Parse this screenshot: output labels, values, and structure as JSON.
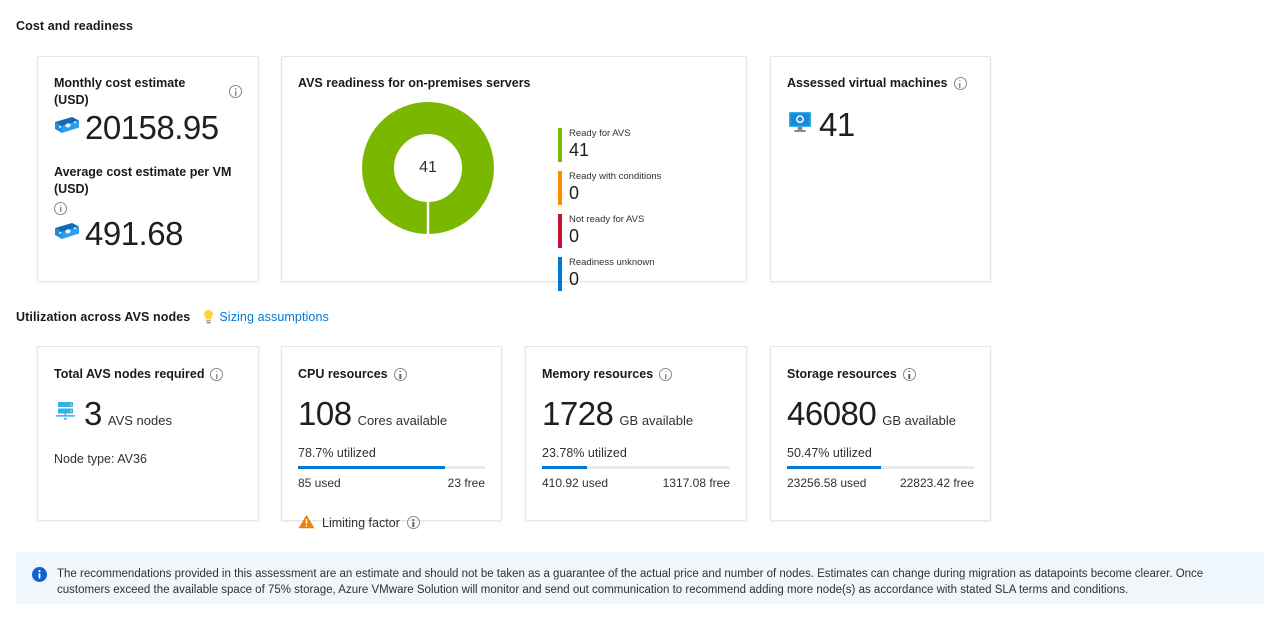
{
  "sections": {
    "cost_readiness": {
      "title": "Cost and readiness"
    },
    "utilization": {
      "title": "Utilization across AVS nodes",
      "link_label": "Sizing assumptions",
      "bulb_icon": "lightbulb-icon"
    }
  },
  "cost_card": {
    "monthly": {
      "title": "Monthly cost estimate (USD)",
      "value": "20158.95",
      "icon": "money-icon",
      "info_icon": "info-icon"
    },
    "average": {
      "title": "Average cost estimate per VM (USD)",
      "value": "491.68",
      "icon": "money-icon",
      "info_icon": "info-icon"
    }
  },
  "readiness_card": {
    "title": "AVS readiness for on-premises servers",
    "center_value": "41"
  },
  "assessed_card": {
    "title": "Assessed virtual machines",
    "value": "41",
    "icon": "virtual-machine-icon",
    "info_icon": "info-icon"
  },
  "nodes_card": {
    "title": "Total AVS nodes required",
    "value": "3",
    "unit": "AVS nodes",
    "node_type": "Node type: AV36",
    "icon": "server-nodes-icon",
    "info_icon": "info-icon"
  },
  "cpu_card": {
    "title": "CPU resources",
    "value": "108",
    "unit": "Cores available",
    "utilized_label": "78.7% utilized",
    "utilized_pct": 78.7,
    "used_label": "85 used",
    "free_label": "23 free",
    "limiting_label": "Limiting factor",
    "warning_icon": "warning-triangle-icon",
    "info_icon": "info-icon"
  },
  "memory_card": {
    "title": "Memory resources",
    "value": "1728",
    "unit": "GB available",
    "utilized_label": "23.78% utilized",
    "utilized_pct": 23.78,
    "used_label": "410.92 used",
    "free_label": "1317.08 free",
    "info_icon": "info-icon"
  },
  "storage_card": {
    "title": "Storage resources",
    "value": "46080",
    "unit": "GB available",
    "utilized_label": "50.47% utilized",
    "utilized_pct": 50.47,
    "used_label": "23256.58 used",
    "free_label": "22823.42 free",
    "info_icon": "info-icon"
  },
  "info_banner": {
    "icon": "info-filled-icon",
    "text": "The recommendations provided in this assessment are an estimate and should not be taken as a guarantee of the actual price and number of nodes. Estimates can change during migration as datapoints become clearer. Once customers exceed the available space of 75% storage, Azure VMware Solution will monitor and send out communication to recommend adding more node(s) as accordance with stated SLA terms and conditions."
  },
  "colors": {
    "ready": "#7ab800",
    "conditions": "#ff8c00",
    "not_ready": "#c4122f",
    "unknown": "#0078d4",
    "accent": "#0078d4",
    "banner_bg": "#eff6fc"
  },
  "chart_data": {
    "type": "pie",
    "title": "AVS readiness for on-premises servers",
    "center_label": "41",
    "categories": [
      "Ready for AVS",
      "Ready with conditions",
      "Not ready for AVS",
      "Readiness unknown"
    ],
    "values": [
      41,
      0,
      0,
      0
    ],
    "colors": [
      "#7ab800",
      "#ff8c00",
      "#c4122f",
      "#0078d4"
    ],
    "total": 41,
    "legend": "right",
    "donut": true
  }
}
